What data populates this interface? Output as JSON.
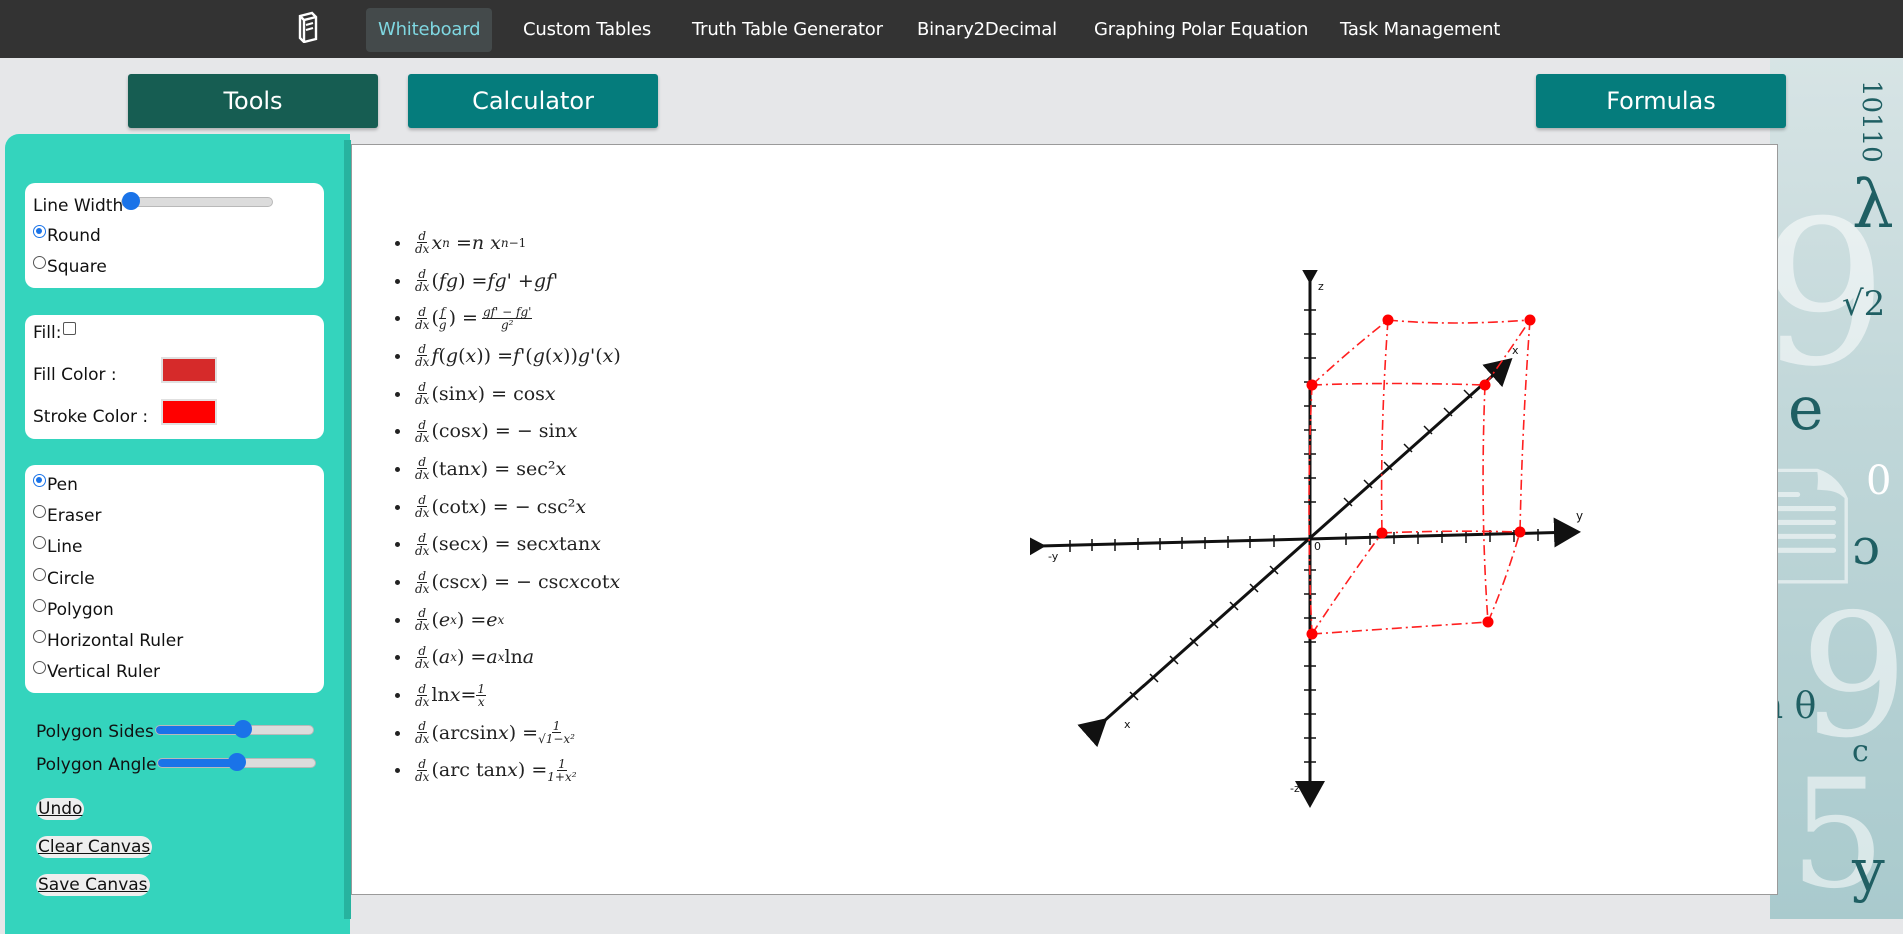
{
  "nav": {
    "logo_icon": "page-logo-icon",
    "items": [
      {
        "label": "Whiteboard",
        "active": true
      },
      {
        "label": "Custom Tables"
      },
      {
        "label": "Truth Table Generator"
      },
      {
        "label": "Binary2Decimal"
      },
      {
        "label": "Graphing Polar Equation"
      },
      {
        "label": "Task Management"
      }
    ]
  },
  "buttons": {
    "tools": "Tools",
    "calculator": "Calculator",
    "formulas": "Formulas"
  },
  "tools": {
    "line_width_label": "Line Width",
    "line_width_value": 0.05,
    "cap_options": [
      "Round",
      "Square"
    ],
    "cap_selected": "Round",
    "fill_label": "Fill:",
    "fill_checked": false,
    "fill_color_label": "Fill Color :",
    "fill_color": "#d62a2a",
    "stroke_color_label": "Stroke Color :",
    "stroke_color": "#ff0000",
    "mode_options": [
      "Pen",
      "Eraser",
      "Line",
      "Circle",
      "Polygon",
      "Horizontal Ruler",
      "Vertical Ruler"
    ],
    "mode_selected": "Pen",
    "polygon_sides_label": "Polygon Sides",
    "polygon_sides_value": 0.56,
    "polygon_angle_label": "Polygon Angle",
    "polygon_angle_value": 0.5,
    "undo_label": "Undo",
    "clear_label": "Clear Canvas",
    "save_label": "Save Canvas"
  },
  "canvas": {
    "formulas": [
      "d/dx xⁿ = n xⁿ⁻¹",
      "d/dx (fg) = fg' + gf'",
      "d/dx (f/g) = (gf' − fg')/g²",
      "d/dx f(g(x)) = f'(g(x)) g'(x)",
      "d/dx (sin x) = cos x",
      "d/dx (cos x) = − sin x",
      "d/dx (tan x) = sec² x",
      "d/dx (cot x) = − csc² x",
      "d/dx (sec x) = sec x tan x",
      "d/dx (csc x) = − csc x cot x",
      "d/dx (eˣ) = eˣ",
      "d/dx (aˣ) = aˣ ln a",
      "d/dx ln x = 1/x",
      "d/dx (arcsin x) = 1/√(1−x²)",
      "d/dx (arc tan x) = 1/(1+x²)"
    ],
    "axis_labels": {
      "z_pos": "z",
      "z_neg": "-z",
      "y_pos": "y",
      "y_neg": "-y",
      "x_pos": "x",
      "x_neg": "x",
      "origin": "0"
    },
    "drawing_color": "#ff0000"
  },
  "background_glyphs": [
    "10110",
    "λ",
    "√2",
    "e",
    "0",
    "ɔ",
    "n θ",
    "c",
    "5",
    "y"
  ]
}
